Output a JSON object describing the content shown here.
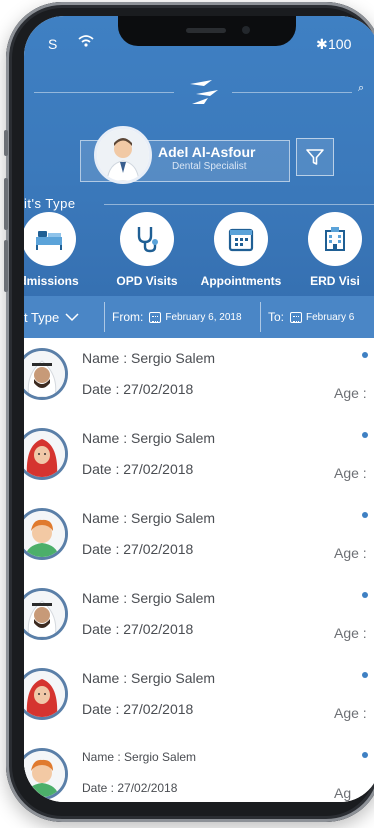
{
  "status_bar": {
    "carrier": "S",
    "battery": "100"
  },
  "profile": {
    "name": "Adel Al-Asfour",
    "specialty": "Dental Specialist"
  },
  "visit_type": {
    "title": "it's Type",
    "items": [
      {
        "label": "dmissions",
        "icon": "hospital-bed-icon"
      },
      {
        "label": "OPD Visits",
        "icon": "stethoscope-icon"
      },
      {
        "label": "Appointments",
        "icon": "calendar-icon"
      },
      {
        "label": "ERD Visi",
        "icon": "hospital-building-icon"
      }
    ]
  },
  "filter_bar": {
    "type_label": "t Type",
    "from_label": "From:",
    "from_date": "February 6, 2018",
    "to_label": "To:",
    "to_date": "February 6"
  },
  "patients": [
    {
      "name": "Name : Sergio Salem",
      "date": "Date : 27/02/2018",
      "age": "Age :",
      "avatar": "man-ghutra-avatar"
    },
    {
      "name": "Name : Sergio Salem",
      "date": "Date : 27/02/2018",
      "age": "Age :",
      "avatar": "woman-hijab-avatar"
    },
    {
      "name": "Name : Sergio Salem",
      "date": "Date : 27/02/2018",
      "age": "Age :",
      "avatar": "child-avatar"
    },
    {
      "name": "Name : Sergio Salem",
      "date": "Date : 27/02/2018",
      "age": "Age :",
      "avatar": "man-ghutra-avatar"
    },
    {
      "name": "Name : Sergio Salem",
      "date": "Date : 27/02/2018",
      "age": "Age :",
      "avatar": "woman-hijab-avatar"
    },
    {
      "name": "Name : Sergio Salem",
      "date": "Date : 27/02/2018",
      "age": "Ag",
      "avatar": "child-avatar"
    }
  ],
  "colors": {
    "primary": "#3f80c3",
    "filter_bar": "#4a86c6",
    "text": "#4a4d52"
  }
}
